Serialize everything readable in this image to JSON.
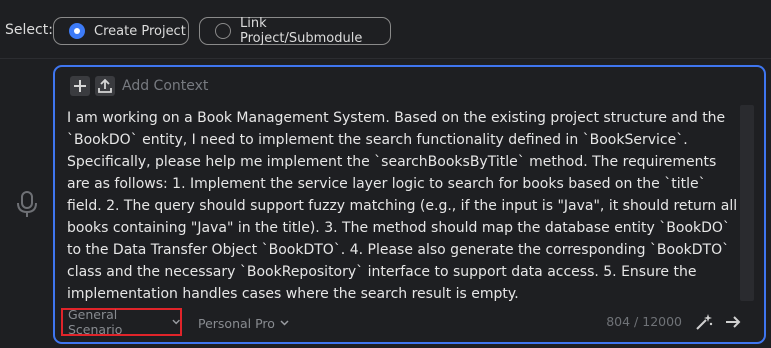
{
  "select": {
    "label": "Select:",
    "options": [
      {
        "label": "Create Project",
        "selected": true
      },
      {
        "label": "Link Project/Submodule",
        "selected": false
      }
    ]
  },
  "composer": {
    "add_context": "Add Context",
    "message": "I am working on a Book Management System. Based on the existing project structure and the `BookDO` entity, I need to implement the search functionality defined in `BookService`. Specifically, please help me implement the `searchBooksByTitle` method.  The requirements are as follows: 1. Implement the service layer logic to search for books based on the `title` field. 2.  The query should support fuzzy matching (e.g., if the input is \"Java\", it should return all books containing \"Java\" in the title). 3.  The method should map the database entity `BookDO` to the Data Transfer Object `BookDTO`. 4.  Please also generate the corresponding `BookDTO` class and the necessary `BookRepository` interface to support data access. 5.  Ensure the implementation handles cases where the search result is empty.",
    "scenario": "General Scenario",
    "model": "Personal Pro",
    "char_count": "804 / 12000"
  },
  "icons": {
    "mic": "microphone-icon",
    "add": "plus-icon",
    "upload": "upload-icon",
    "wand": "magic-wand-icon",
    "send": "send-arrow-icon",
    "chevron": "chevron-down-icon"
  },
  "colors": {
    "accent": "#3f76f0",
    "radio_selected": "#3d7bf7",
    "highlight_border": "#e0242a",
    "background": "#1e1f22"
  }
}
